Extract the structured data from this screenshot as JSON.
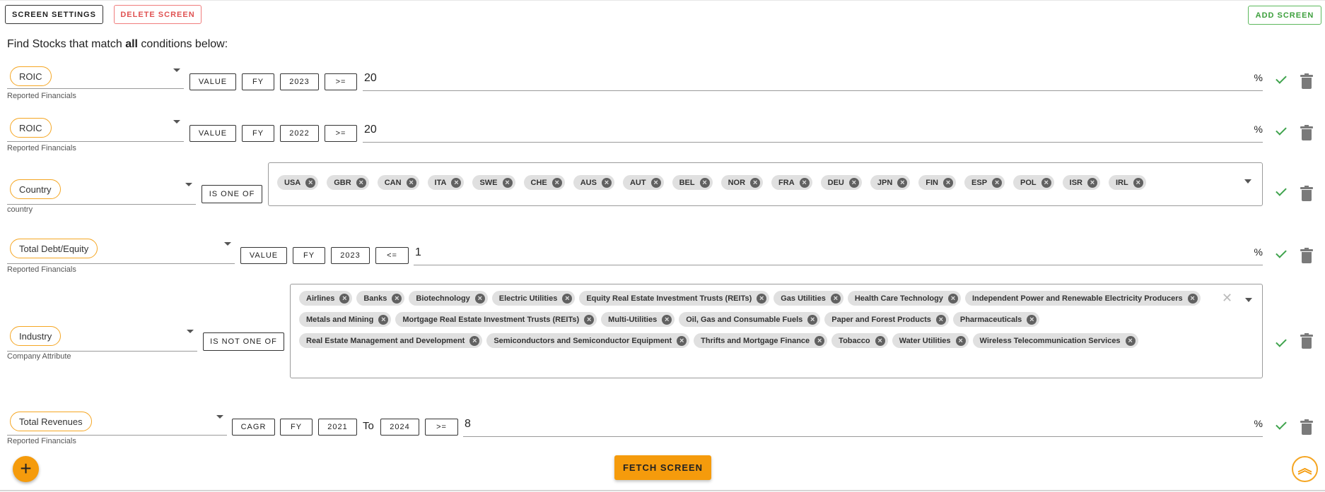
{
  "toolbar": {
    "screen_settings": "SCREEN SETTINGS",
    "delete_screen": "DELETE SCREEN",
    "add_screen": "ADD SCREEN"
  },
  "intro": {
    "prefix": "Find Stocks that match ",
    "emphasis": "all",
    "suffix": " conditions below:"
  },
  "rows": [
    {
      "metric": "ROIC",
      "category": "Reported Financials",
      "params": [
        "VALUE",
        "FY",
        "2023",
        ">="
      ],
      "value": "20",
      "unit": "%"
    },
    {
      "metric": "ROIC",
      "category": "Reported Financials",
      "params": [
        "VALUE",
        "FY",
        "2022",
        ">="
      ],
      "value": "20",
      "unit": "%"
    },
    {
      "metric": "Country",
      "category": "country",
      "operator": "IS ONE OF",
      "chips": [
        "USA",
        "GBR",
        "CAN",
        "ITA",
        "SWE",
        "CHE",
        "AUS",
        "AUT",
        "BEL",
        "NOR",
        "FRA",
        "DEU",
        "JPN",
        "FIN",
        "ESP",
        "POL",
        "ISR",
        "IRL"
      ]
    },
    {
      "metric": "Total Debt/Equity",
      "category": "Reported Financials",
      "params": [
        "VALUE",
        "FY",
        "2023",
        "<="
      ],
      "value": "1",
      "unit": "%"
    },
    {
      "metric": "Industry",
      "category": "Company Attribute",
      "operator": "IS NOT ONE OF",
      "chips": [
        "Airlines",
        "Banks",
        "Biotechnology",
        "Electric Utilities",
        "Equity Real Estate Investment Trusts (REITs)",
        "Gas Utilities",
        "Health Care Technology",
        "Independent Power and Renewable Electricity Producers",
        "Metals and Mining",
        "Mortgage Real Estate Investment Trusts (REITs)",
        "Multi-Utilities",
        "Oil, Gas and Consumable Fuels",
        "Paper and Forest Products",
        "Pharmaceuticals",
        "Real Estate Management and Development",
        "Semiconductors and Semiconductor Equipment",
        "Thrifts and Mortgage Finance",
        "Tobacco",
        "Water Utilities",
        "Wireless Telecommunication Services"
      ]
    },
    {
      "metric": "Total Revenues",
      "category": "Reported Financials",
      "params": [
        "CAGR",
        "FY",
        "2021",
        "2024",
        ">="
      ],
      "to_label": "To",
      "value": "8",
      "unit": "%"
    }
  ],
  "actions": {
    "fab": "+",
    "fetch": "FETCH SCREEN",
    "scroll_top": "︽"
  },
  "icons": {
    "confirm": "check-icon",
    "delete": "trash-icon",
    "add": "plus-icon",
    "collapse": "double-chevron-up-icon"
  },
  "colors": {
    "accent": "#f59b0c",
    "confirm": "#3fa34d",
    "danger": "#e05252",
    "success": "#3c9f3c"
  }
}
